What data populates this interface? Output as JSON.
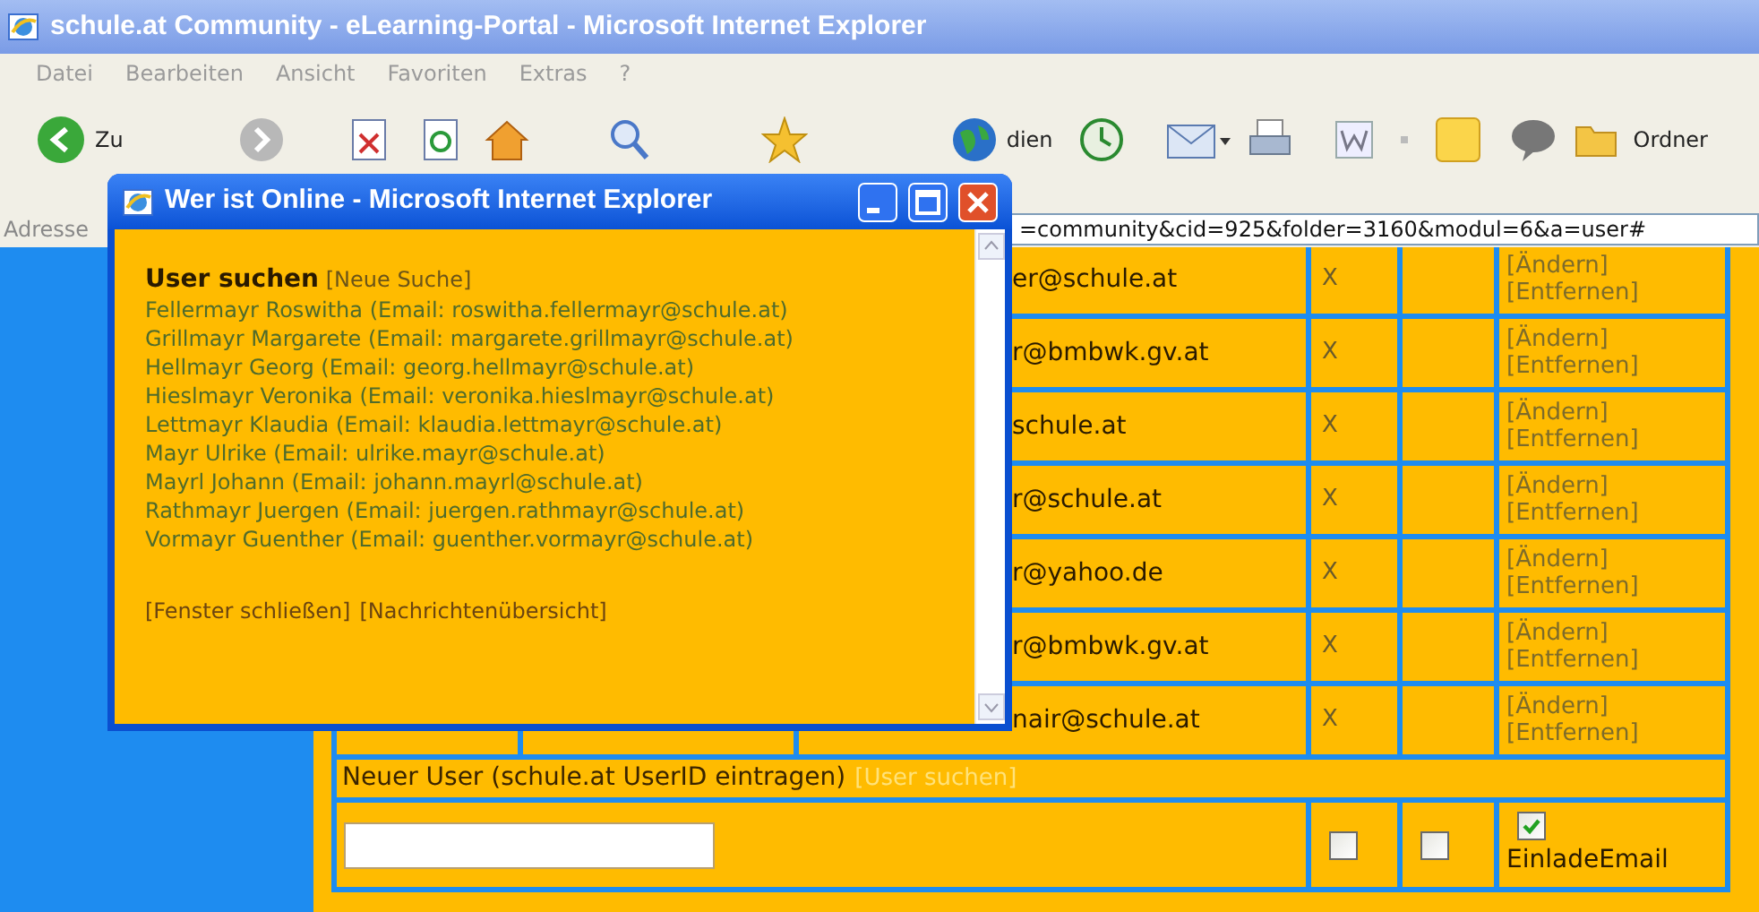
{
  "window": {
    "title": "schule.at Community - eLearning-Portal - Microsoft Internet Explorer"
  },
  "menu": [
    "Datei",
    "Bearbeiten",
    "Ansicht",
    "Favoriten",
    "Extras",
    "?"
  ],
  "toolbar": {
    "back_label": "Zu",
    "media_label": "dien",
    "folders_label": "Ordner"
  },
  "address_bar": {
    "label": "Adresse",
    "value": "=community&cid=925&folder=3160&modul=6&a=user#"
  },
  "users_table": {
    "rows": [
      {
        "email": "er@schule.at",
        "column_4": "X",
        "actions": [
          "[Ändern]",
          "[Entfernen]"
        ]
      },
      {
        "email": "r@bmbwk.gv.at",
        "column_4": "X",
        "actions": [
          "[Ändern]",
          "[Entfernen]"
        ]
      },
      {
        "email": "schule.at",
        "column_4": "X",
        "actions": [
          "[Ändern]",
          "[Entfernen]"
        ]
      },
      {
        "email": "r@schule.at",
        "column_4": "X",
        "actions": [
          "[Ändern]",
          "[Entfernen]"
        ]
      },
      {
        "email": "r@yahoo.de",
        "column_4": "X",
        "actions": [
          "[Ändern]",
          "[Entfernen]"
        ]
      },
      {
        "email": "r@bmbwk.gv.at",
        "column_4": "X",
        "actions": [
          "[Ändern]",
          "[Entfernen]"
        ]
      },
      {
        "email": "nair@schule.at",
        "column_4": "X",
        "actions": [
          "[Ändern]",
          "[Entfernen]"
        ]
      }
    ],
    "new_user": {
      "label": "Neuer User (schule.at UserID eintragen)",
      "link": "[User suchen]"
    },
    "new_user_options": [
      {
        "checked": false
      },
      {
        "checked": false
      },
      {
        "checked": true,
        "label": "EinladeEmail"
      }
    ]
  },
  "popup": {
    "title": "Wer ist Online - Microsoft Internet Explorer",
    "heading": "User suchen",
    "heading_link": "[Neue Suche]",
    "results": [
      "Fellermayr Roswitha (Email: roswitha.fellermayr@schule.at)",
      "Grillmayr Margarete (Email: margarete.grillmayr@schule.at)",
      "Hellmayr Georg (Email: georg.hellmayr@schule.at)",
      "Hieslmayr Veronika (Email: veronika.hieslmayr@schule.at)",
      "Lettmayr Klaudia (Email: klaudia.lettmayr@schule.at)",
      "Mayr Ulrike (Email: ulrike.mayr@schule.at)",
      "Mayrl Johann (Email: johann.mayrl@schule.at)",
      "Rathmayr Juergen (Email: juergen.rathmayr@schule.at)",
      "Vormayr Guenther (Email: guenther.vormayr@schule.at)"
    ],
    "links": [
      "[Fenster schließen]",
      "[Nachrichtenübersicht]"
    ]
  }
}
